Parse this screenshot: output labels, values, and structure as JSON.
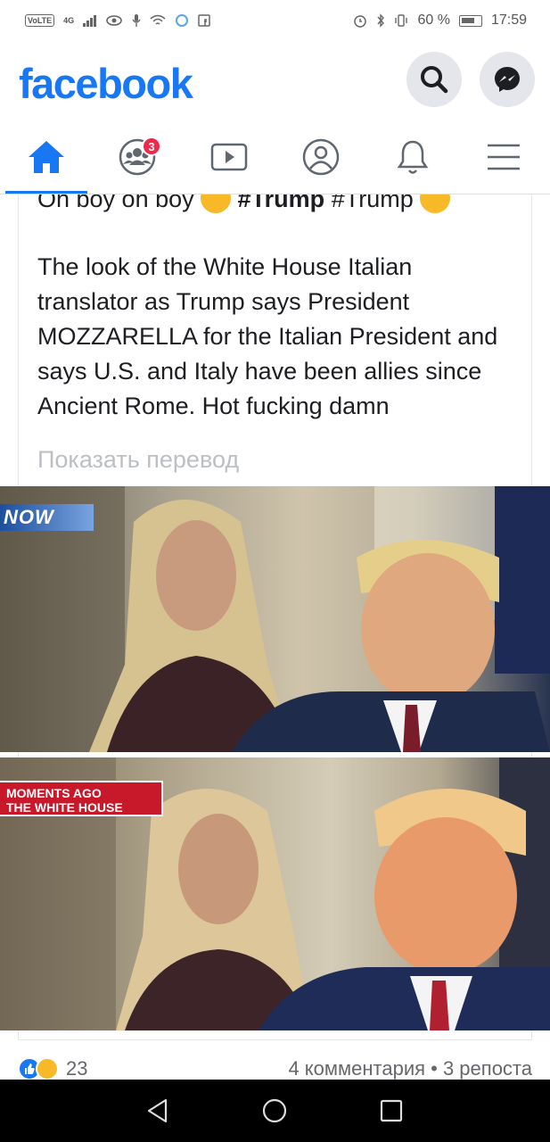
{
  "status_bar": {
    "volte": "VoLTE",
    "signal_type": "4G",
    "battery_percent": "60 %",
    "time": "17:59"
  },
  "header": {
    "logo": "facebook",
    "search_icon": "search-icon",
    "messenger_icon": "messenger-icon"
  },
  "nav": {
    "tabs": [
      {
        "icon": "home-icon",
        "active": true
      },
      {
        "icon": "groups-icon",
        "badge": "3"
      },
      {
        "icon": "watch-icon"
      },
      {
        "icon": "profile-icon"
      },
      {
        "icon": "bell-icon"
      },
      {
        "icon": "menu-icon"
      }
    ],
    "accent": "#1877f2",
    "badge_color": "#f02849"
  },
  "post": {
    "cutoff_line_prefix": "Oh boy oh boy",
    "hashtag_1": "#Trump",
    "hashtag_2": "#Trump",
    "text": "The look of the White House Italian translator as Trump says President MOZZARELLA for the Italian President and says U.S. and Italy have been allies since Ancient Rome. Hot fucking damn",
    "translate_link": "Показать перевод",
    "photo_1": {
      "overlay_logo": "NOW"
    },
    "photo_2": {
      "chyron_line_1": "MOMENTS AGO",
      "chyron_line_2": "THE WHITE HOUSE"
    },
    "reaction_count": "23",
    "comments_shares": "4 комментария • 3 репоста"
  },
  "system_nav": {
    "back_icon": "back-icon",
    "home_icon": "home-circle-icon",
    "recents_icon": "recents-icon"
  }
}
